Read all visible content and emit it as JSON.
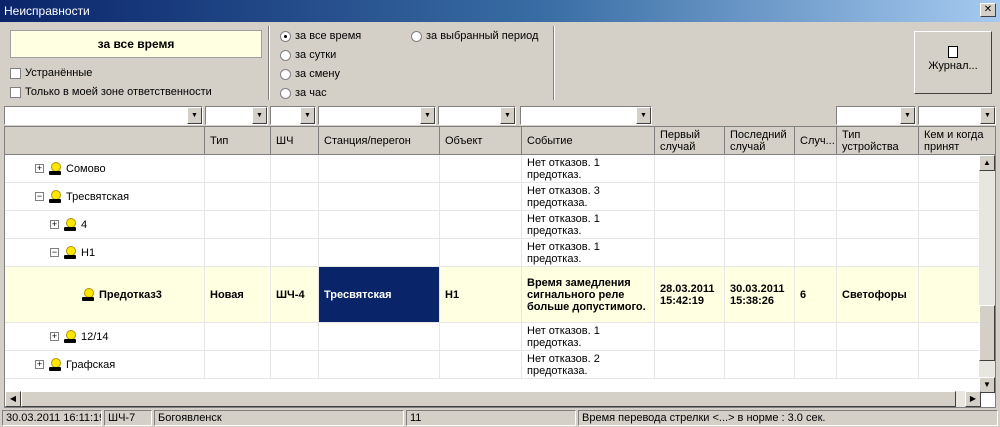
{
  "window": {
    "title": "Неисправности",
    "close": "✕"
  },
  "filters": {
    "period_display": "за все время",
    "checkboxes": [
      "Устранённые",
      "Только в моей зоне ответственности"
    ],
    "radios": [
      "за все время",
      "за сутки",
      "за смену",
      "за час"
    ],
    "radio_selected_period": "за выбранный период",
    "journal_button": "Журнал..."
  },
  "grid": {
    "headers": [
      "Тип",
      "ШЧ",
      "Станция/перегон",
      "Объект",
      "Событие",
      "Первый случай",
      "Последний случай",
      "Случ...",
      "Тип устройства",
      "Кем и когда принят"
    ],
    "rows": [
      {
        "name": "Сомово",
        "event": "Нет отказов. 1 предотказ."
      },
      {
        "name": "Тресвятская",
        "event": "Нет отказов. 3 предотказа."
      },
      {
        "name": "4",
        "event": "Нет отказов. 1 предотказ."
      },
      {
        "name": "Н1",
        "event": "Нет отказов. 1 предотказ."
      },
      {
        "name": "Предотказ3",
        "type": "Новая",
        "shch": "ШЧ-4",
        "station": "Тресвятская",
        "object": "Н1",
        "event": "Время замедления сигнального реле больше допустимого.",
        "first": "28.03.2011 15:42:19",
        "last": "30.03.2011 15:38:26",
        "count": "6",
        "device": "Светофоры"
      },
      {
        "name": "12/14",
        "event": "Нет отказов. 1 предотказ."
      },
      {
        "name": "Графская",
        "event": "Нет отказов. 2 предотказа."
      }
    ]
  },
  "status": {
    "datetime": "30.03.2011 16:11:19",
    "shch": "ШЧ-7",
    "station": "Богоявленск",
    "code": "11",
    "message": "Время перевода стрелки <...> в норме : 3.0 сек."
  }
}
